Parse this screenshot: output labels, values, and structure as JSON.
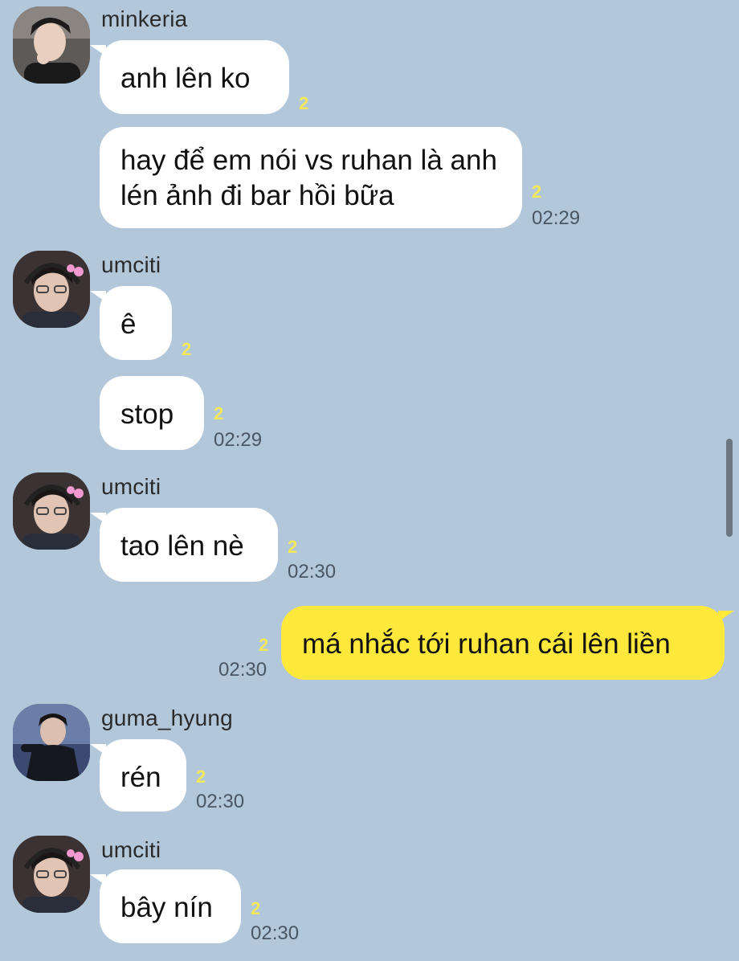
{
  "colors": {
    "background": "#b2c7da",
    "bubble_in": "#ffffff",
    "bubble_out": "#ffe83c",
    "unread": "#f3e85a",
    "time": "#4a5663"
  },
  "messages": [
    {
      "sender": "minkeria",
      "avatar": "minkeria-avatar",
      "bubbles": [
        {
          "text": "anh lên ko",
          "unread": "2",
          "time": ""
        },
        {
          "text": "hay để em nói vs ruhan là anh lén ảnh đi bar hồi bữa",
          "unread": "2",
          "time": "02:29"
        }
      ]
    },
    {
      "sender": "umciti",
      "avatar": "umciti-avatar",
      "bubbles": [
        {
          "text": "ê",
          "unread": "2",
          "time": ""
        },
        {
          "text": "stop",
          "unread": "2",
          "time": "02:29"
        }
      ]
    },
    {
      "sender": "umciti",
      "avatar": "umciti-avatar",
      "bubbles": [
        {
          "text": "tao lên nè",
          "unread": "2",
          "time": "02:30"
        }
      ]
    },
    {
      "sender": "",
      "mine": true,
      "bubbles": [
        {
          "text": "má nhắc tới ruhan cái lên liền",
          "unread": "2",
          "time": "02:30"
        }
      ]
    },
    {
      "sender": "guma_hyung",
      "avatar": "guma-hyung-avatar",
      "bubbles": [
        {
          "text": "rén",
          "unread": "2",
          "time": "02:30"
        }
      ]
    },
    {
      "sender": "umciti",
      "avatar": "umciti-avatar",
      "bubbles": [
        {
          "text": "bây nín",
          "unread": "2",
          "time": "02:30"
        }
      ]
    }
  ]
}
